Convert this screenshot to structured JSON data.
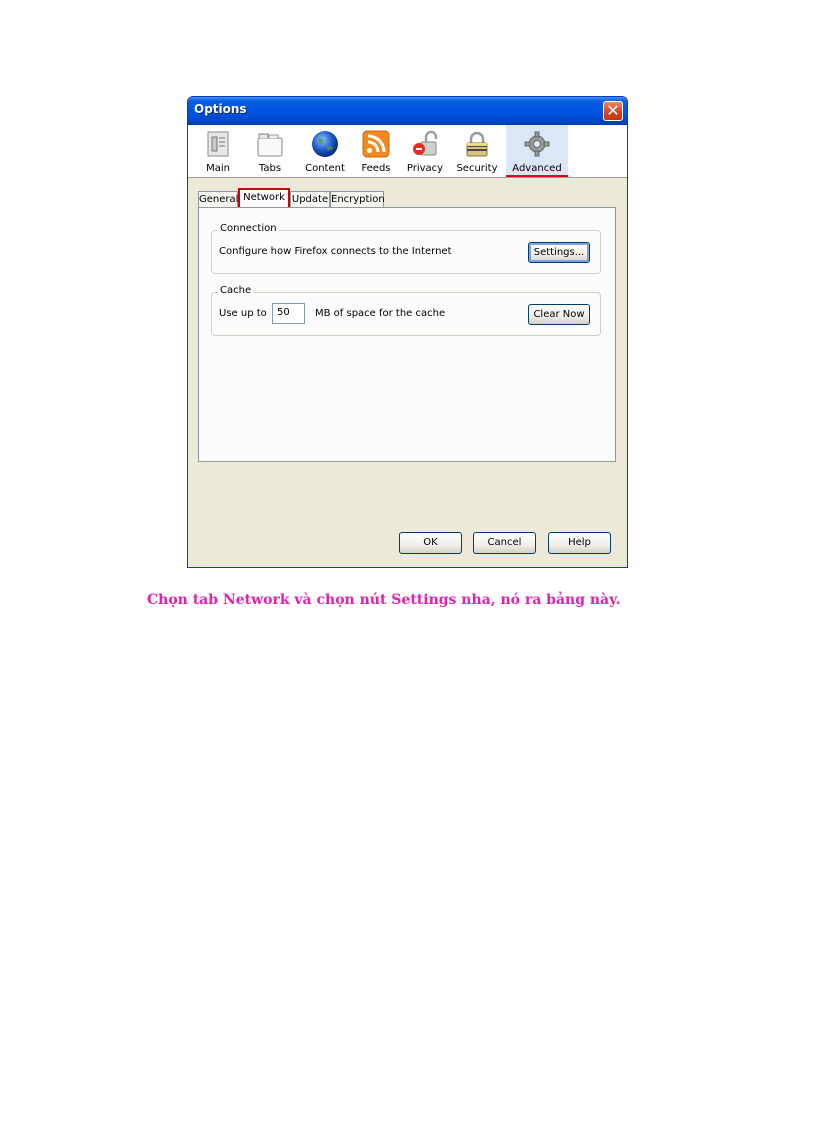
{
  "window": {
    "title": "Options",
    "close_glyph": "✕"
  },
  "panes": [
    {
      "label": "Main",
      "icon": "main-icon",
      "selected": false
    },
    {
      "label": "Tabs",
      "icon": "tabs-icon",
      "selected": false
    },
    {
      "label": "Content",
      "icon": "globe-icon",
      "selected": false
    },
    {
      "label": "Feeds",
      "icon": "rss-feed-icon",
      "selected": false
    },
    {
      "label": "Privacy",
      "icon": "padlock-icon",
      "selected": false
    },
    {
      "label": "Security",
      "icon": "security-icon",
      "selected": false
    },
    {
      "label": "Advanced",
      "icon": "gear-icon",
      "selected": true
    }
  ],
  "tabs": [
    {
      "label": "General",
      "active": false
    },
    {
      "label": "Network",
      "active": true
    },
    {
      "label": "Update",
      "active": false
    },
    {
      "label": "Encryption",
      "active": false
    }
  ],
  "connection": {
    "legend": "Connection",
    "description": "Configure how Firefox connects to the Internet",
    "settings_label": "Settings..."
  },
  "cache": {
    "legend": "Cache",
    "use_up_to_label": "Use up to",
    "size_value": "50",
    "suffix": "MB of space for the cache",
    "clear_label": "Clear Now"
  },
  "footer": {
    "ok_label": "OK",
    "cancel_label": "Cancel",
    "help_label": "Help"
  },
  "caption": "Chọn tab Network và chọn nút Settings nha, nó ra bảng này.",
  "colors": {
    "highlight": "#d0000a",
    "caption": "#e021b4",
    "titlebar": "#0054e3"
  }
}
